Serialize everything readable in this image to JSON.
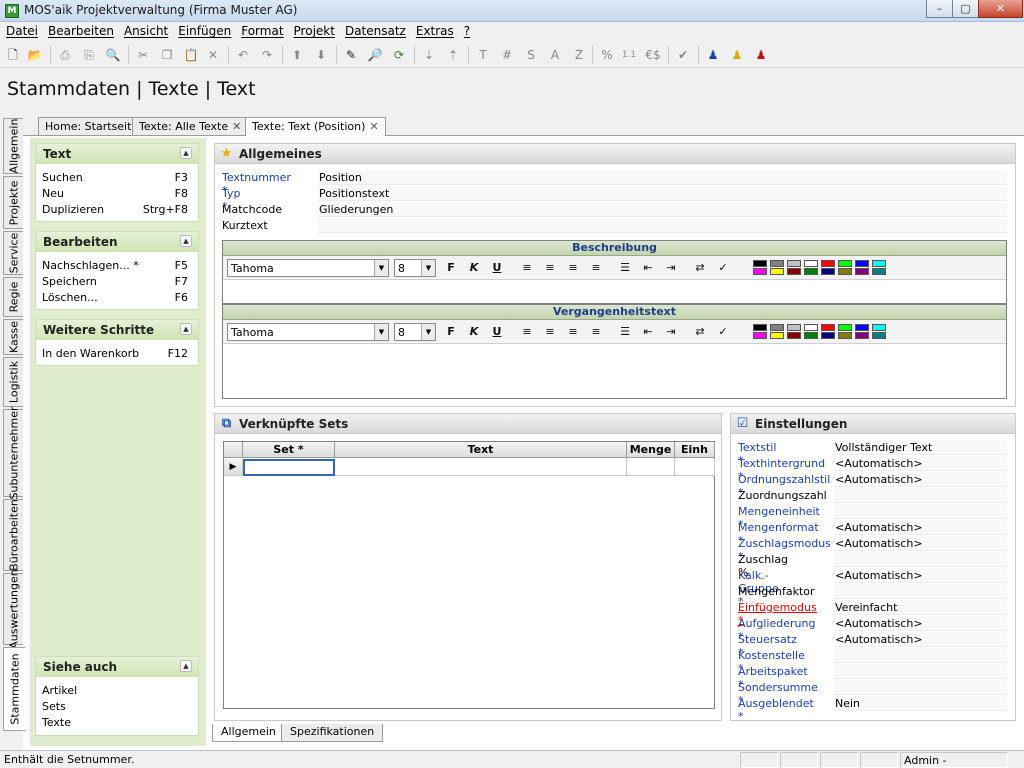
{
  "window": {
    "app_icon": "M",
    "title": "MOS'aik Projektverwaltung (Firma Muster AG)",
    "buttons": {
      "minimize": "–",
      "maximize": "▢",
      "close": "✕"
    }
  },
  "menu": [
    "Datei",
    "Bearbeiten",
    "Ansicht",
    "Einfügen",
    "Format",
    "Projekt",
    "Datensatz",
    "Extras",
    "?"
  ],
  "toolbar": {
    "icons": [
      "new-file-icon",
      "open-folder-icon",
      "print-icon",
      "print-preview-icon",
      "preview-icon",
      "cut-icon",
      "copy-icon",
      "paste-icon",
      "delete-icon",
      "undo-icon",
      "redo-icon",
      "up-arrow-icon",
      "down-arrow-icon",
      "edit-pencil-icon",
      "search-doc-icon",
      "refresh-icon",
      "sort-asc-icon",
      "sort-desc-icon",
      "t-icon",
      "hash-icon",
      "s-icon",
      "a-icon",
      "z-icon",
      "percent-icon",
      "numbering-icon",
      "currency-icon",
      "check-icon",
      "user-blue-icon",
      "user-yellow-icon",
      "user-red-icon"
    ],
    "glyphs": {
      "t": "T",
      "hash": "#",
      "s": "S",
      "a": "A",
      "z": "Z",
      "percent": "%",
      "numbering": "1.1",
      "currency": "€$"
    }
  },
  "page_title": "Stammdaten | Texte | Text",
  "doc_tabs": [
    {
      "label": "Home: Startseite",
      "closable": false
    },
    {
      "label": "Texte: Alle Texte",
      "closable": true
    },
    {
      "label": "Texte: Text (Position)",
      "closable": true,
      "active": true
    }
  ],
  "vertical_tabs": [
    "Allgemein",
    "Projekte",
    "Service",
    "Regie",
    "Kasse",
    "Logistik",
    "Subunternehmer",
    "Büroarbeiten",
    "Auswertungen",
    "Stammdaten"
  ],
  "left_panel": {
    "groups": [
      {
        "title": "Text",
        "items": [
          {
            "label": "Suchen",
            "key": "F3"
          },
          {
            "label": "Neu",
            "key": "F8"
          },
          {
            "label": "Duplizieren",
            "key": "Strg+F8"
          }
        ]
      },
      {
        "title": "Bearbeiten",
        "items": [
          {
            "label": "Nachschlagen... *",
            "key": "F5"
          },
          {
            "label": "Speichern",
            "key": "F7"
          },
          {
            "label": "Löschen...",
            "key": "F6"
          }
        ]
      },
      {
        "title": "Weitere Schritte",
        "items": [
          {
            "label": "In den Warenkorb",
            "key": "F12"
          }
        ]
      }
    ],
    "see_also": {
      "title": "Siehe auch",
      "items": [
        "Artikel",
        "Sets",
        "Texte"
      ]
    }
  },
  "allgemeines": {
    "title": "Allgemeines",
    "fields": [
      {
        "label": "Textnummer *",
        "value": "Position",
        "required": true
      },
      {
        "label": "Typ *",
        "value": "Positionstext",
        "required": true
      },
      {
        "label": "Matchcode",
        "value": "Gliederungen",
        "required": false
      },
      {
        "label": "Kurztext",
        "value": "",
        "required": false
      }
    ],
    "editors": [
      {
        "title": "Beschreibung",
        "font": "Tahoma",
        "size": "8"
      },
      {
        "title": "Vergangenheitstext",
        "font": "Tahoma",
        "size": "8"
      }
    ],
    "format_buttons": {
      "bold": "F",
      "italic": "K",
      "underline": "U"
    },
    "palette": [
      "#000000",
      "#808080",
      "#c0c0c0",
      "#ffffff",
      "#ff0000",
      "#00ff00",
      "#0000ff",
      "#00ffff",
      "#ff00ff",
      "#ffff00",
      "#800000",
      "#008000",
      "#000080",
      "#808000",
      "#800080",
      "#008080"
    ]
  },
  "sets": {
    "title": "Verknüpfte Sets",
    "columns": [
      "Set *",
      "Text",
      "Menge",
      "Einh"
    ]
  },
  "einstellungen": {
    "title": "Einstellungen",
    "fields": [
      {
        "label": "Textstil *",
        "value": "Vollständiger Text",
        "kind": "req"
      },
      {
        "label": "Texthintergrund *",
        "value": "<Automatisch>",
        "kind": "req"
      },
      {
        "label": "Ordnungszahlstil *",
        "value": "<Automatisch>",
        "kind": "req"
      },
      {
        "label": "Zuordnungszahl",
        "value": "",
        "kind": "normal"
      },
      {
        "label": "Mengeneinheit *",
        "value": "",
        "kind": "req"
      },
      {
        "label": "Mengenformat *",
        "value": "<Automatisch>",
        "kind": "req"
      },
      {
        "label": "Zuschlagsmodus *",
        "value": "<Automatisch>",
        "kind": "req"
      },
      {
        "label": "Zuschlag %",
        "value": "",
        "kind": "normal"
      },
      {
        "label": "Kalk.-Gruppe *",
        "value": "<Automatisch>",
        "kind": "req"
      },
      {
        "label": "Mengenfaktor",
        "value": "",
        "kind": "normal"
      },
      {
        "label": "Einfügemodus *",
        "value": "Vereinfacht",
        "kind": "error"
      },
      {
        "label": "Aufgliederung *",
        "value": "<Automatisch>",
        "kind": "req"
      },
      {
        "label": "Steuersatz *",
        "value": "<Automatisch>",
        "kind": "req"
      },
      {
        "label": "Kostenstelle *",
        "value": "",
        "kind": "req"
      },
      {
        "label": "Arbeitspaket *",
        "value": "",
        "kind": "req"
      },
      {
        "label": "Sondersumme *",
        "value": "",
        "kind": "req"
      },
      {
        "label": "Ausgeblendet *",
        "value": "Nein",
        "kind": "req"
      }
    ]
  },
  "bottom_tabs": [
    "Allgemein",
    "Spezifikationen"
  ],
  "status": {
    "text": "Enthält die Setnummer.",
    "user": "Admin - Mosaik.mdb"
  },
  "colors": {
    "required_label": "#1c3ea8",
    "error_label": "#e00000",
    "panel_green": "#dfeccd"
  }
}
